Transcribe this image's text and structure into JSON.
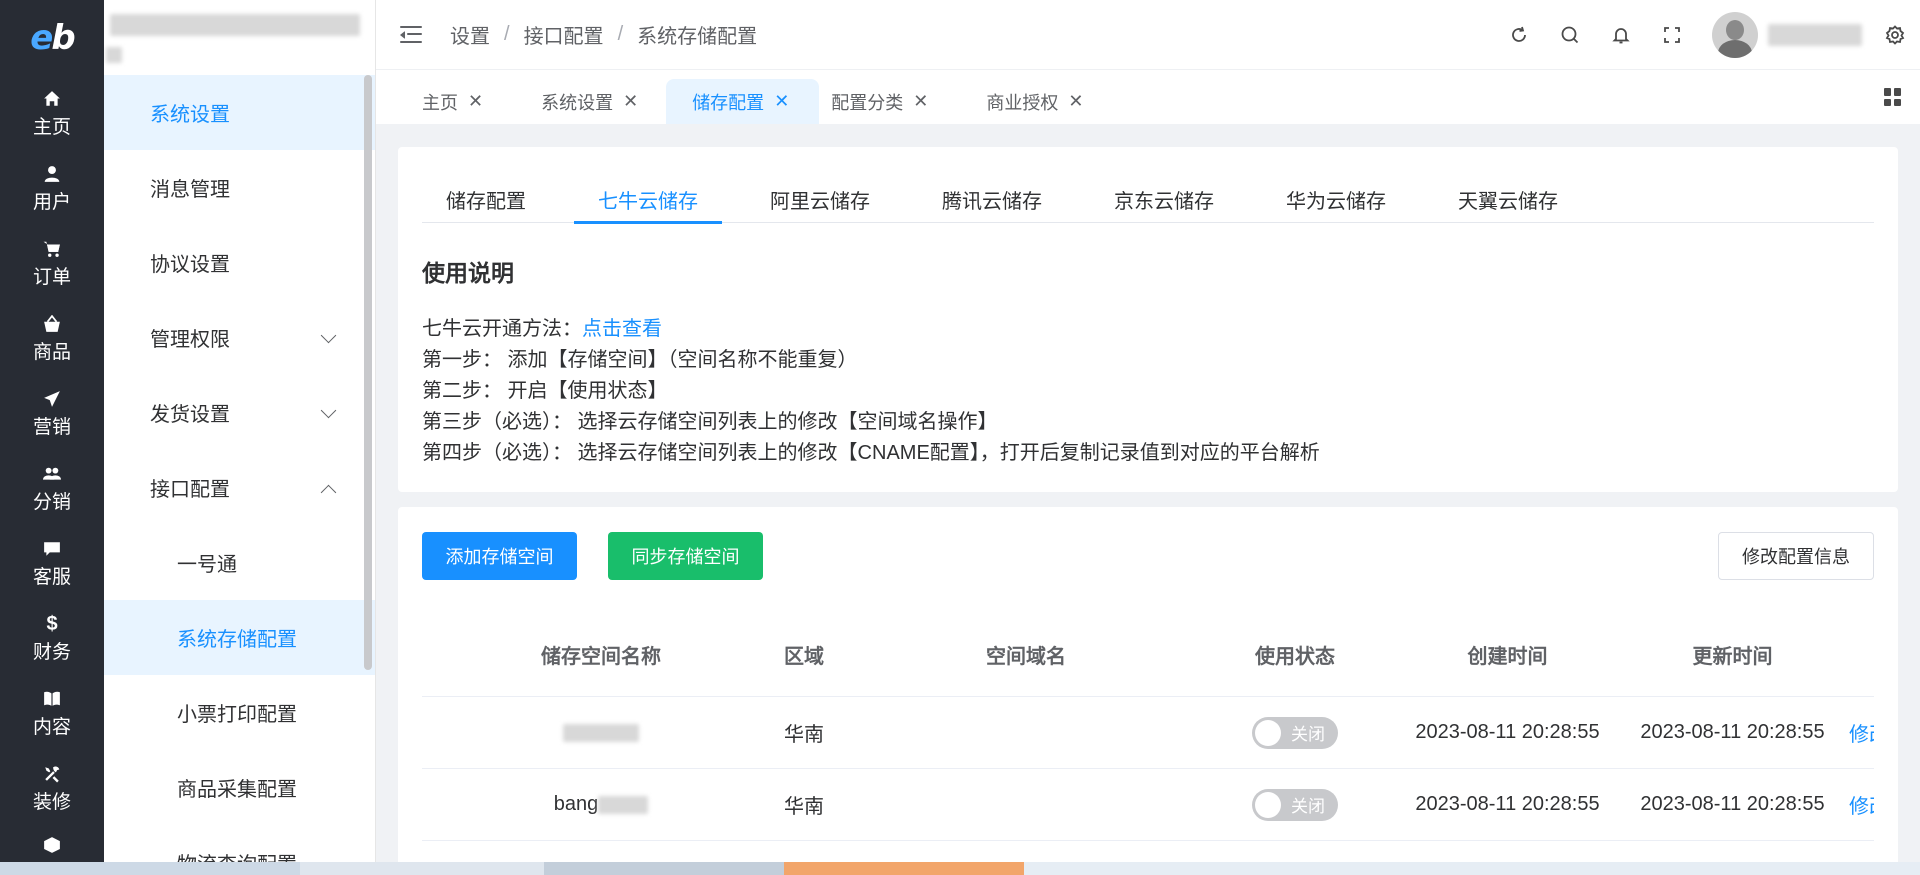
{
  "rail": {
    "logo": "eb",
    "items": [
      {
        "label": "主页",
        "icon": "home-icon"
      },
      {
        "label": "用户",
        "icon": "user-icon"
      },
      {
        "label": "订单",
        "icon": "cart-icon"
      },
      {
        "label": "商品",
        "icon": "basket-icon"
      },
      {
        "label": "营销",
        "icon": "send-icon"
      },
      {
        "label": "分销",
        "icon": "group-icon"
      },
      {
        "label": "客服",
        "icon": "chat-icon"
      },
      {
        "label": "财务",
        "icon": "dollar-icon"
      },
      {
        "label": "内容",
        "icon": "book-icon"
      },
      {
        "label": "装修",
        "icon": "tools-icon"
      }
    ]
  },
  "submenu": {
    "items": [
      {
        "label": "系统设置"
      },
      {
        "label": "消息管理"
      },
      {
        "label": "协议设置"
      },
      {
        "label": "管理权限"
      },
      {
        "label": "发货设置"
      },
      {
        "label": "接口配置"
      },
      {
        "label": "一号通"
      },
      {
        "label": "系统存储配置"
      },
      {
        "label": "小票打印配置"
      },
      {
        "label": "商品采集配置"
      },
      {
        "label": "物流查询配置"
      }
    ]
  },
  "header": {
    "breadcrumb": [
      "设置",
      "接口配置",
      "系统存储配置"
    ]
  },
  "page_tabs": [
    {
      "label": "主页"
    },
    {
      "label": "系统设置"
    },
    {
      "label": "储存配置"
    },
    {
      "label": "配置分类"
    },
    {
      "label": "商业授权"
    }
  ],
  "close_glyph": "✕",
  "storage_tabs": [
    "储存配置",
    "七牛云储存",
    "阿里云储存",
    "腾讯云储存",
    "京东云储存",
    "华为云储存",
    "天翼云储存"
  ],
  "instructions": {
    "title": "使用说明",
    "line1_prefix": "七牛云开通方法：",
    "line1_link": "点击查看",
    "line2": "第一步： 添加【存储空间】（空间名称不能重复）",
    "line3": "第二步： 开启【使用状态】",
    "line4": "第三步（必选）： 选择云存储空间列表上的修改【空间域名操作】",
    "line5": "第四步（必选）： 选择云存储空间列表上的修改【CNAME配置】，打开后复制记录值到对应的平台解析"
  },
  "toolbar": {
    "add_label": "添加存储空间",
    "sync_label": "同步存储空间",
    "edit_label": "修改配置信息"
  },
  "table": {
    "headers": [
      "储存空间名称",
      "区域",
      "空间域名",
      "使用状态",
      "创建时间",
      "更新时间"
    ],
    "rows": [
      {
        "name": "",
        "region": "华南",
        "domain": "",
        "status": "关闭",
        "created": "2023-08-11 20:28:55",
        "updated": "2023-08-11 20:28:55",
        "action": "修改空"
      },
      {
        "name": "bang",
        "region": "华南",
        "domain": "",
        "status": "关闭",
        "created": "2023-08-11 20:28:55",
        "updated": "2023-08-11 20:28:55",
        "action": "修改空"
      }
    ]
  },
  "colors": {
    "primary": "#1890ff",
    "success": "#19be6b",
    "rail_bg": "#282c34",
    "switch_off": "#c8c9cc"
  }
}
